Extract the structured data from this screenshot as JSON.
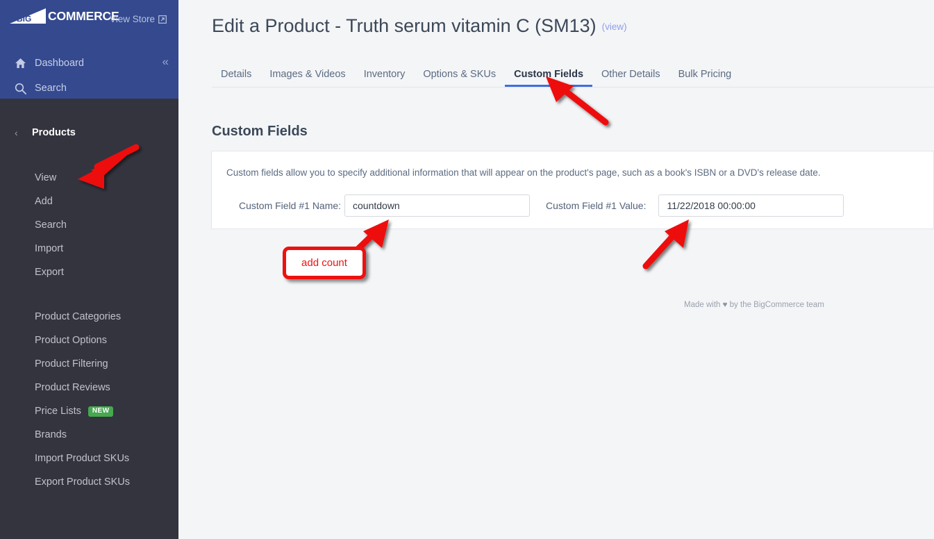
{
  "sidebar": {
    "brand": {
      "mark": "bigcommerce-flag-logo",
      "big": "BIG",
      "commerce": "COMMERCE"
    },
    "view_store": {
      "label": "View Store",
      "icon": "external-link-icon"
    },
    "collapse": {
      "icon": "double-chevron-left-icon",
      "glyph": "«"
    },
    "top_items": [
      {
        "label": "Dashboard",
        "icon": "home-icon"
      },
      {
        "label": "Search",
        "icon": "search-icon"
      }
    ],
    "section": {
      "title": "Products",
      "back_icon": "chevron-left-icon",
      "back_glyph": "‹"
    },
    "links": [
      {
        "label": "View"
      },
      {
        "label": "Add"
      },
      {
        "label": "Search"
      },
      {
        "label": "Import"
      },
      {
        "label": "Export"
      },
      {
        "label": "Product Categories"
      },
      {
        "label": "Product Options"
      },
      {
        "label": "Product Filtering"
      },
      {
        "label": "Product Reviews"
      },
      {
        "label": "Price Lists",
        "badge": "NEW"
      },
      {
        "label": "Brands"
      },
      {
        "label": "Import Product SKUs"
      },
      {
        "label": "Export Product SKUs"
      }
    ]
  },
  "header": {
    "title": "Edit a Product - Truth serum vitamin C (SM13)",
    "view_link": "(view)"
  },
  "tabs": [
    {
      "label": "Details",
      "active": false
    },
    {
      "label": "Images & Videos",
      "active": false
    },
    {
      "label": "Inventory",
      "active": false
    },
    {
      "label": "Options & SKUs",
      "active": false
    },
    {
      "label": "Custom Fields",
      "active": true
    },
    {
      "label": "Other Details",
      "active": false
    },
    {
      "label": "Bulk Pricing",
      "active": false
    }
  ],
  "main": {
    "section_heading": "Custom Fields",
    "description": "Custom fields allow you to specify additional information that will appear on the product's page, such as a book's ISBN or a DVD's release date.",
    "fields": [
      {
        "label": "Custom Field #1 Name:",
        "value": "countdown",
        "placeholder": ""
      },
      {
        "label": "Custom Field #1 Value:",
        "value": "11/22/2018 00:00:00",
        "placeholder": ""
      }
    ]
  },
  "footer": {
    "prefix": "Made with",
    "heart": "♥",
    "suffix": "by the BigCommerce team"
  },
  "annotations": {
    "color": "#ee1111",
    "callout_text": "add count",
    "arrows": [
      {
        "name": "arrow-to-view-nav-item",
        "points_to": "View"
      },
      {
        "name": "arrow-to-custom-fields-tab",
        "points_to": "Custom Fields"
      },
      {
        "name": "arrow-to-field-name-input",
        "points_to": "Custom Field #1 Name input"
      },
      {
        "name": "arrow-to-field-value-input",
        "points_to": "Custom Field #1 Value input"
      }
    ]
  },
  "colors": {
    "sidebar_header": "#34498e",
    "sidebar_body": "#34343f",
    "page_bg": "#f4f5f7",
    "panel_bg": "#ffffff",
    "tab_active_underline": "#3f6ee0",
    "badge_new": "#46a84f",
    "annotation_red": "#ee1111"
  }
}
